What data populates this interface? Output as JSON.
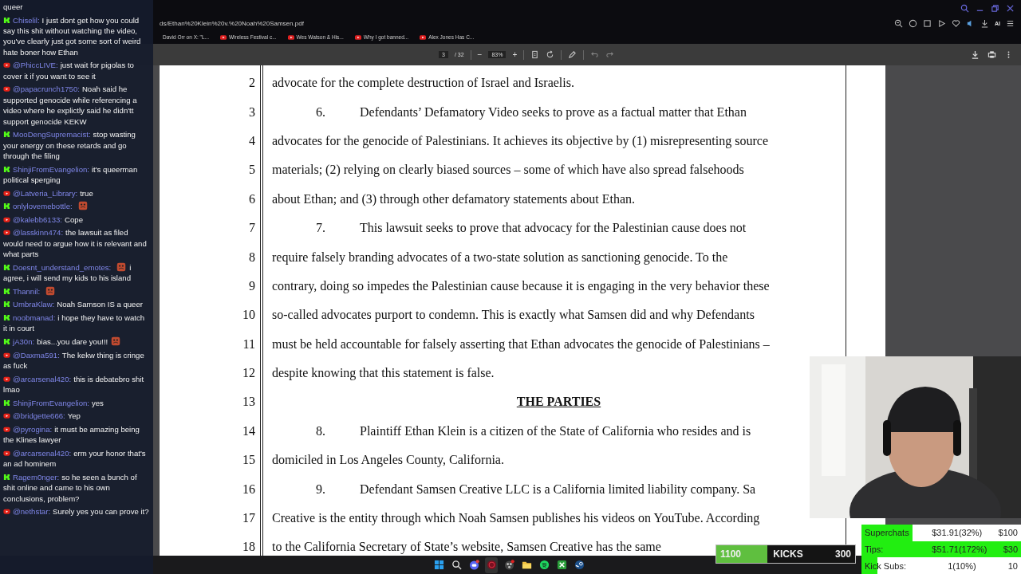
{
  "browser": {
    "address": "ds/Ethan%20Klein%20v.%20Noah%20Samsen.pdf",
    "toolbar_ai": "AI",
    "bookmarks": [
      {
        "kind": "x",
        "label": "David Orr on X: \"L..."
      },
      {
        "kind": "youtube",
        "label": "Wireless Festival c..."
      },
      {
        "kind": "youtube",
        "label": "Wes Watson & His..."
      },
      {
        "kind": "youtube",
        "label": "Why I got banned..."
      },
      {
        "kind": "youtube",
        "label": "Alex Jones Has C..."
      }
    ]
  },
  "pdf_toolbar": {
    "page": "3",
    "page_count": "/ 32",
    "zoom": "83%",
    "zoom_out": "−",
    "zoom_in": "+"
  },
  "document": {
    "lines": [
      {
        "number": "2",
        "kind": "text",
        "text": "advocate for the complete destruction of Israel and Israelis."
      },
      {
        "number": "3",
        "kind": "paragraph",
        "para_number": "6.",
        "text": "Defendants’ Defamatory Video seeks to prove as a factual matter that Ethan"
      },
      {
        "number": "4",
        "kind": "text",
        "text": "advocates for the genocide of Palestinians. It achieves its objective by (1) misrepresenting source"
      },
      {
        "number": "5",
        "kind": "text",
        "text": "materials; (2) relying on clearly biased sources – some of which have also spread falsehoods"
      },
      {
        "number": "6",
        "kind": "text",
        "text": "about Ethan; and (3) through other defamatory statements about Ethan."
      },
      {
        "number": "7",
        "kind": "paragraph",
        "para_number": "7.",
        "text": "This lawsuit seeks to prove that advocacy for the Palestinian cause does not"
      },
      {
        "number": "8",
        "kind": "text",
        "text": "require falsely branding advocates of a two-state solution as sanctioning genocide. To the"
      },
      {
        "number": "9",
        "kind": "text",
        "text": "contrary, doing so impedes the Palestinian cause because it is engaging in the very behavior these"
      },
      {
        "number": "10",
        "kind": "text",
        "text": "so-called advocates purport to condemn. This is exactly what Samsen did and why Defendants"
      },
      {
        "number": "11",
        "kind": "text",
        "text": "must be held accountable for falsely asserting that Ethan advocates the genocide of Palestinians –"
      },
      {
        "number": "12",
        "kind": "text",
        "text": "despite knowing that this statement is false."
      },
      {
        "number": "13",
        "kind": "heading",
        "text": "THE PARTIES"
      },
      {
        "number": "14",
        "kind": "paragraph",
        "para_number": "8.",
        "text": "Plaintiff Ethan Klein is a citizen of the State of California who resides and is"
      },
      {
        "number": "15",
        "kind": "text",
        "text": "domiciled in Los Angeles County, California."
      },
      {
        "number": "16",
        "kind": "paragraph",
        "para_number": "9.",
        "text": "Defendant Samsen Creative LLC is a California limited liability company. Sa"
      },
      {
        "number": "17",
        "kind": "text",
        "text": "Creative is the entity through which Noah Samsen publishes his videos on YouTube. According"
      },
      {
        "number": "18",
        "kind": "text",
        "text": "to the California Secretary of State’s website, Samsen Creative has the same"
      }
    ]
  },
  "chat": [
    {
      "kind": "fragment",
      "text": "queer"
    },
    {
      "kind": "kick",
      "user": "Chiselil:",
      "text": "I just dont get how you could say this shit without watching the video, you've clearly just got some sort of weird hate boner how Ethan"
    },
    {
      "kind": "youtube",
      "user": "@PhiccLIVE:",
      "text": "just wait for pigolas to cover it if you want to see it"
    },
    {
      "kind": "youtube",
      "user": "@papacrunch1750:",
      "text": "Noah said he supported genocide while referencing a video where he explictly said he didn'tt support genocide KEKW"
    },
    {
      "kind": "kick",
      "user": "MooDengSupremacist:",
      "text": "stop wasting your energy on these retards and go through the filing"
    },
    {
      "kind": "kick",
      "user": "ShinjiFromEvangelion:",
      "text": "it's queerman political sperging"
    },
    {
      "kind": "youtube",
      "user": "@Latveria_Library:",
      "text": "true"
    },
    {
      "kind": "kick",
      "user": "onlylovemebottle:",
      "parts": [
        {
          "kind": "emote"
        }
      ]
    },
    {
      "kind": "youtube",
      "user": "@kalebb6133:",
      "text": "Cope"
    },
    {
      "kind": "youtube",
      "user": "@lasskinn474:",
      "text": "the lawsuit as filed would need to argue how it is relevant and what parts"
    },
    {
      "kind": "kick",
      "user": "Doesnt_understand_emotes:",
      "parts": [
        {
          "kind": "emote"
        },
        {
          "kind": "text",
          "text": "i agree, i will send my kids to his island"
        }
      ]
    },
    {
      "kind": "kick",
      "user": "Thannil:",
      "parts": [
        {
          "kind": "emote"
        }
      ]
    },
    {
      "kind": "kick",
      "user": "UmbraKlaw:",
      "text": "Noah Samson IS a queer"
    },
    {
      "kind": "kick",
      "user": "noobmanad:",
      "text": "i hope they have to watch it in court"
    },
    {
      "kind": "kick",
      "user": "jA30n:",
      "parts": [
        {
          "kind": "text",
          "text": "bias...you dare you!!!"
        },
        {
          "kind": "emote"
        }
      ]
    },
    {
      "kind": "youtube",
      "user": "@Daxma591:",
      "text": "The kekw thing is cringe as fuck"
    },
    {
      "kind": "youtube",
      "user": "@arcarsenal420:",
      "text": "this is debatebro shit lmao"
    },
    {
      "kind": "kick",
      "user": "ShinjiFromEvangelion:",
      "text": "yes"
    },
    {
      "kind": "youtube",
      "user": "@bridgette666:",
      "text": "Yep"
    },
    {
      "kind": "youtube",
      "user": "@pyrogina:",
      "text": "it must be amazing being the Klines lawyer"
    },
    {
      "kind": "youtube",
      "user": "@arcarsenal420:",
      "text": "erm your honor that's an ad hominem"
    },
    {
      "kind": "kick",
      "user": "Ragem0nger:",
      "text": "so he seen a bunch of shit online and came to his own conclusions, problem?"
    },
    {
      "kind": "youtube",
      "user": "@nethstar:",
      "text": "Surely yes you can prove it?"
    }
  ],
  "goals": [
    {
      "label": "Superchats",
      "amount": "$31.91(32%)",
      "target": "$100",
      "level": 0.32
    },
    {
      "label": "Tips:",
      "amount": "$51.71(172%)",
      "target": "$30",
      "level": 1
    },
    {
      "label": "Kick Subs:",
      "amount": "1(10%)",
      "target": "10",
      "level": 0.1
    }
  ],
  "kicks_bar": {
    "current": "1100",
    "label": "KICKS",
    "target": "300",
    "level": 0.37
  },
  "taskbar": [
    {
      "kind": "windows"
    },
    {
      "kind": "search"
    },
    {
      "kind": "round-app",
      "badge": true
    },
    {
      "kind": "record",
      "active": true
    },
    {
      "kind": "dots",
      "badge": true
    },
    {
      "kind": "folder"
    },
    {
      "kind": "music"
    },
    {
      "kind": "xtile"
    },
    {
      "kind": "steam"
    }
  ]
}
